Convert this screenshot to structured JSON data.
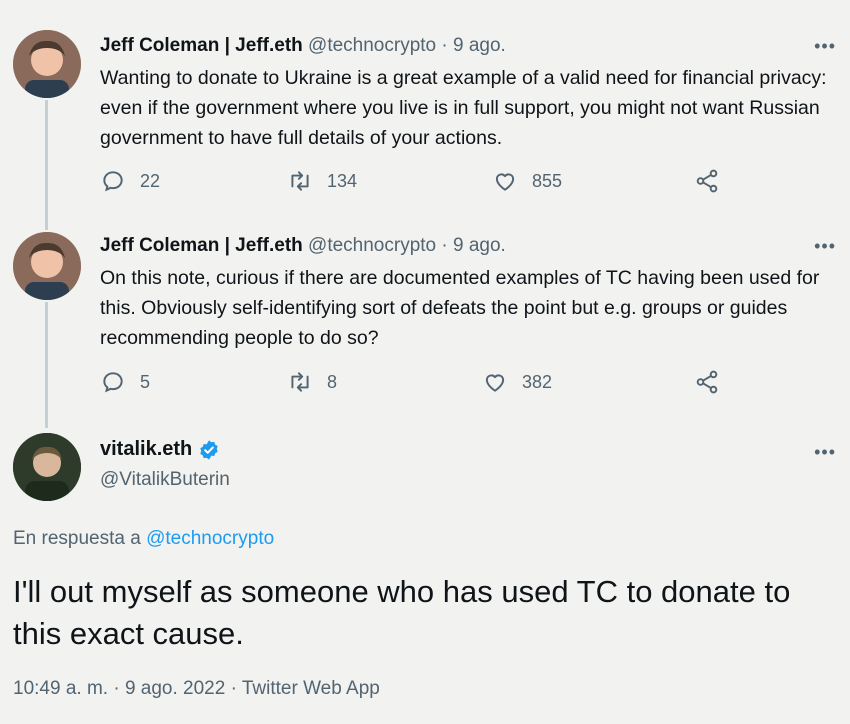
{
  "tweets": [
    {
      "name": "Jeff Coleman | Jeff.eth",
      "handle": "@technocrypto",
      "sep": "·",
      "date": "9 ago.",
      "text": "Wanting to donate to Ukraine is a great example of a valid need for financial privacy: even if the government where you live is in full support, you might not want Russian government to have full details of your actions.",
      "replies": "22",
      "retweets": "134",
      "likes": "855"
    },
    {
      "name": "Jeff Coleman | Jeff.eth",
      "handle": "@technocrypto",
      "sep": "·",
      "date": "9 ago.",
      "text": "On this note, curious if there are documented examples of TC having been used for this. Obviously self-identifying sort of defeats the point but e.g. groups or guides recommending people to do so?",
      "replies": "5",
      "retweets": "8",
      "likes": "382"
    }
  ],
  "main": {
    "name": "vitalik.eth",
    "handle": "@VitalikButerin",
    "reply_prefix": "En respuesta a",
    "reply_mention": "@technocrypto",
    "text": "I'll out myself as someone who has used TC to donate to this exact cause.",
    "meta": "10:49 a. m. · 9 ago. 2022 · Twitter Web App"
  },
  "more_label": "•••",
  "colors": {
    "background": "#f2f2f0",
    "secondary_text": "#536471",
    "accent": "#1d9bf0",
    "thread_line": "#c4cfd6"
  },
  "icons": [
    "more-icon",
    "reply-icon",
    "retweet-icon",
    "like-icon",
    "share-icon",
    "verified-badge-icon"
  ]
}
